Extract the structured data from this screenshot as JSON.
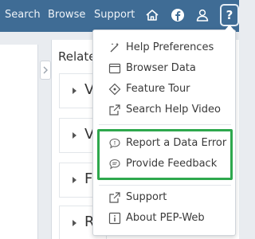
{
  "nav": {
    "links": [
      "Search",
      "Browse",
      "Support"
    ]
  },
  "content": {
    "related_heading": "Relate",
    "accordion_letters": [
      "V",
      "V",
      "F",
      "R"
    ]
  },
  "help_menu": {
    "items": [
      {
        "label": "Help Preferences",
        "icon": "wand-icon"
      },
      {
        "label": "Browser Data",
        "icon": "window-icon"
      },
      {
        "label": "Feature Tour",
        "icon": "tag-icon"
      },
      {
        "label": "Search Help Video",
        "icon": "external-link-icon"
      },
      {
        "label": "Report a Data Error",
        "icon": "speech-bubble-icon"
      },
      {
        "label": "Provide Feedback",
        "icon": "speech-bubble-lines-icon"
      },
      {
        "label": "Support",
        "icon": "external-link-icon"
      },
      {
        "label": "About PEP-Web",
        "icon": "info-icon"
      }
    ]
  },
  "colors": {
    "nav_bar": "#3f6c95",
    "highlight": "#2ea84d"
  }
}
